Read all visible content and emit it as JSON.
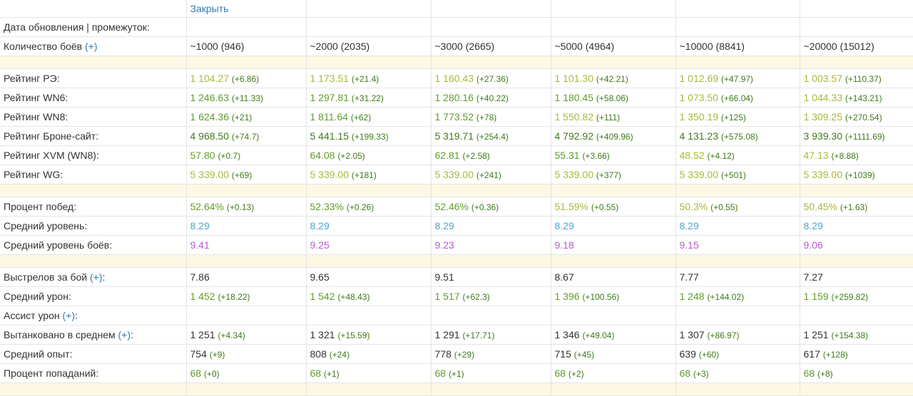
{
  "close_link": "Закрыть",
  "colors": {
    "best": "#3e7a1c",
    "good": "#5f9e2a",
    "avg": "#a8b93a",
    "level": "#4aa9c8",
    "battle_level": "#b65bc9",
    "plain": "#333333",
    "delta": "#3e7a1c",
    "link": "#337ab7",
    "spacer": "#fcf8e3"
  },
  "plus_label": "(+)",
  "rows": [
    {
      "type": "row",
      "label": "Дата обновления | промежуток:",
      "cells": []
    },
    {
      "type": "row",
      "label": "Количество боёв",
      "plus": true,
      "cells": [
        {
          "v": "~1000 (946)",
          "c": "plain"
        },
        {
          "v": "~2000 (2035)",
          "c": "plain"
        },
        {
          "v": "~3000 (2665)",
          "c": "plain"
        },
        {
          "v": "~5000 (4964)",
          "c": "plain"
        },
        {
          "v": "~10000 (8841)",
          "c": "plain"
        },
        {
          "v": "~20000 (15012)",
          "c": "plain"
        }
      ]
    },
    {
      "type": "spacer"
    },
    {
      "type": "row",
      "label": "Рейтинг РЭ:",
      "cells": [
        {
          "v": "1 104.27",
          "d": "(+6.86)",
          "c": "avg"
        },
        {
          "v": "1 173.51",
          "d": "(+21.4)",
          "c": "avg"
        },
        {
          "v": "1 160.43",
          "d": "(+27.36)",
          "c": "avg"
        },
        {
          "v": "1 101.30",
          "d": "(+42.21)",
          "c": "avg"
        },
        {
          "v": "1 012.69",
          "d": "(+47.97)",
          "c": "avg"
        },
        {
          "v": "1 003.57",
          "d": "(+110.37)",
          "c": "avg"
        }
      ]
    },
    {
      "type": "row",
      "label": "Рейтинг WN6:",
      "cells": [
        {
          "v": "1 246.63",
          "d": "(+11.33)",
          "c": "good"
        },
        {
          "v": "1 297.81",
          "d": "(+31.22)",
          "c": "good"
        },
        {
          "v": "1 280.16",
          "d": "(+40.22)",
          "c": "good"
        },
        {
          "v": "1 180.45",
          "d": "(+58.06)",
          "c": "good"
        },
        {
          "v": "1 073.50",
          "d": "(+66.04)",
          "c": "avg"
        },
        {
          "v": "1 044.33",
          "d": "(+143.21)",
          "c": "avg"
        }
      ]
    },
    {
      "type": "row",
      "label": "Рейтинг WN8:",
      "cells": [
        {
          "v": "1 624.36",
          "d": "(+21)",
          "c": "good"
        },
        {
          "v": "1 811.64",
          "d": "(+62)",
          "c": "good"
        },
        {
          "v": "1 773.52",
          "d": "(+78)",
          "c": "good"
        },
        {
          "v": "1 550.82",
          "d": "(+111)",
          "c": "avg"
        },
        {
          "v": "1 350.19",
          "d": "(+125)",
          "c": "avg"
        },
        {
          "v": "1 309.25",
          "d": "(+270.54)",
          "c": "avg"
        }
      ]
    },
    {
      "type": "row",
      "label": "Рейтинг Броне-сайт:",
      "cells": [
        {
          "v": "4 968.50",
          "d": "(+74.7)",
          "c": "best"
        },
        {
          "v": "5 441.15",
          "d": "(+199.33)",
          "c": "best"
        },
        {
          "v": "5 319.71",
          "d": "(+254.4)",
          "c": "best"
        },
        {
          "v": "4 792.92",
          "d": "(+409.96)",
          "c": "best"
        },
        {
          "v": "4 131.23",
          "d": "(+575.08)",
          "c": "best"
        },
        {
          "v": "3 939.30",
          "d": "(+1111.69)",
          "c": "best"
        }
      ]
    },
    {
      "type": "row",
      "label": "Рейтинг XVM (WN8):",
      "cells": [
        {
          "v": "57.80",
          "d": "(+0.7)",
          "c": "good"
        },
        {
          "v": "64.08",
          "d": "(+2.05)",
          "c": "good"
        },
        {
          "v": "62.81",
          "d": "(+2.58)",
          "c": "good"
        },
        {
          "v": "55.31",
          "d": "(+3.66)",
          "c": "good"
        },
        {
          "v": "48.52",
          "d": "(+4.12)",
          "c": "avg"
        },
        {
          "v": "47.13",
          "d": "(+8.88)",
          "c": "avg"
        }
      ]
    },
    {
      "type": "row",
      "label": "Рейтинг WG:",
      "cells": [
        {
          "v": "5 339.00",
          "d": "(+69)",
          "c": "avg"
        },
        {
          "v": "5 339.00",
          "d": "(+181)",
          "c": "avg"
        },
        {
          "v": "5 339.00",
          "d": "(+241)",
          "c": "avg"
        },
        {
          "v": "5 339.00",
          "d": "(+377)",
          "c": "avg"
        },
        {
          "v": "5 339.00",
          "d": "(+501)",
          "c": "avg"
        },
        {
          "v": "5 339.00",
          "d": "(+1039)",
          "c": "avg"
        }
      ]
    },
    {
      "type": "spacer"
    },
    {
      "type": "row",
      "label": "Процент побед:",
      "cells": [
        {
          "v": "52.64%",
          "d": "(+0.13)",
          "c": "good"
        },
        {
          "v": "52.33%",
          "d": "(+0.26)",
          "c": "good"
        },
        {
          "v": "52.46%",
          "d": "(+0.36)",
          "c": "good"
        },
        {
          "v": "51.59%",
          "d": "(+0.55)",
          "c": "avg"
        },
        {
          "v": "50.3%",
          "d": "(+0.55)",
          "c": "avg"
        },
        {
          "v": "50.45%",
          "d": "(+1.63)",
          "c": "avg"
        }
      ]
    },
    {
      "type": "row",
      "label": "Средний уровень:",
      "cells": [
        {
          "v": "8.29",
          "c": "level"
        },
        {
          "v": "8.29",
          "c": "level"
        },
        {
          "v": "8.29",
          "c": "level"
        },
        {
          "v": "8.29",
          "c": "level"
        },
        {
          "v": "8.29",
          "c": "level"
        },
        {
          "v": "8.29",
          "c": "level"
        }
      ]
    },
    {
      "type": "row",
      "label": "Средний уровень боёв:",
      "cells": [
        {
          "v": "9.41",
          "c": "battle_level"
        },
        {
          "v": "9.25",
          "c": "battle_level"
        },
        {
          "v": "9.23",
          "c": "battle_level"
        },
        {
          "v": "9.18",
          "c": "battle_level"
        },
        {
          "v": "9.15",
          "c": "battle_level"
        },
        {
          "v": "9.06",
          "c": "battle_level"
        }
      ]
    },
    {
      "type": "spacer"
    },
    {
      "type": "row",
      "label": "Выстрелов за бой",
      "plus": true,
      "suffix": ":",
      "cells": [
        {
          "v": "7.86",
          "c": "plain"
        },
        {
          "v": "9.65",
          "c": "plain"
        },
        {
          "v": "9.51",
          "c": "plain"
        },
        {
          "v": "8.67",
          "c": "plain"
        },
        {
          "v": "7.77",
          "c": "plain"
        },
        {
          "v": "7.27",
          "c": "plain"
        }
      ]
    },
    {
      "type": "row",
      "label": "Средний урон:",
      "cells": [
        {
          "v": "1 452",
          "d": "(+18.22)",
          "c": "good"
        },
        {
          "v": "1 542",
          "d": "(+48.43)",
          "c": "good"
        },
        {
          "v": "1 517",
          "d": "(+62.3)",
          "c": "good"
        },
        {
          "v": "1 396",
          "d": "(+100.56)",
          "c": "good"
        },
        {
          "v": "1 248",
          "d": "(+144.02)",
          "c": "good"
        },
        {
          "v": "1 159",
          "d": "(+259.82)",
          "c": "good"
        }
      ]
    },
    {
      "type": "row",
      "label": "Ассист урон",
      "plus": true,
      "suffix": ":",
      "cells": []
    },
    {
      "type": "row",
      "label": "Вытанковано в среднем",
      "plus": true,
      "suffix": ":",
      "cells": [
        {
          "v": "1 251",
          "d": "(+4.34)",
          "c": "plain"
        },
        {
          "v": "1 321",
          "d": "(+15.59)",
          "c": "plain"
        },
        {
          "v": "1 291",
          "d": "(+17.71)",
          "c": "plain"
        },
        {
          "v": "1 346",
          "d": "(+49.04)",
          "c": "plain"
        },
        {
          "v": "1 307",
          "d": "(+86.97)",
          "c": "plain"
        },
        {
          "v": "1 251",
          "d": "(+154.38)",
          "c": "plain"
        }
      ]
    },
    {
      "type": "row",
      "label": "Средний опыт:",
      "cells": [
        {
          "v": "754",
          "d": "(+9)",
          "c": "plain"
        },
        {
          "v": "808",
          "d": "(+24)",
          "c": "plain"
        },
        {
          "v": "778",
          "d": "(+29)",
          "c": "plain"
        },
        {
          "v": "715",
          "d": "(+45)",
          "c": "plain"
        },
        {
          "v": "639",
          "d": "(+60)",
          "c": "plain"
        },
        {
          "v": "617",
          "d": "(+128)",
          "c": "plain"
        }
      ]
    },
    {
      "type": "row",
      "label": "Процент попаданий:",
      "cells": [
        {
          "v": "68",
          "d": "(+0)",
          "c": "good"
        },
        {
          "v": "68",
          "d": "(+1)",
          "c": "good"
        },
        {
          "v": "68",
          "d": "(+1)",
          "c": "good"
        },
        {
          "v": "68",
          "d": "(+2)",
          "c": "good"
        },
        {
          "v": "68",
          "d": "(+3)",
          "c": "good"
        },
        {
          "v": "68",
          "d": "(+8)",
          "c": "good"
        }
      ]
    },
    {
      "type": "spacer"
    }
  ]
}
